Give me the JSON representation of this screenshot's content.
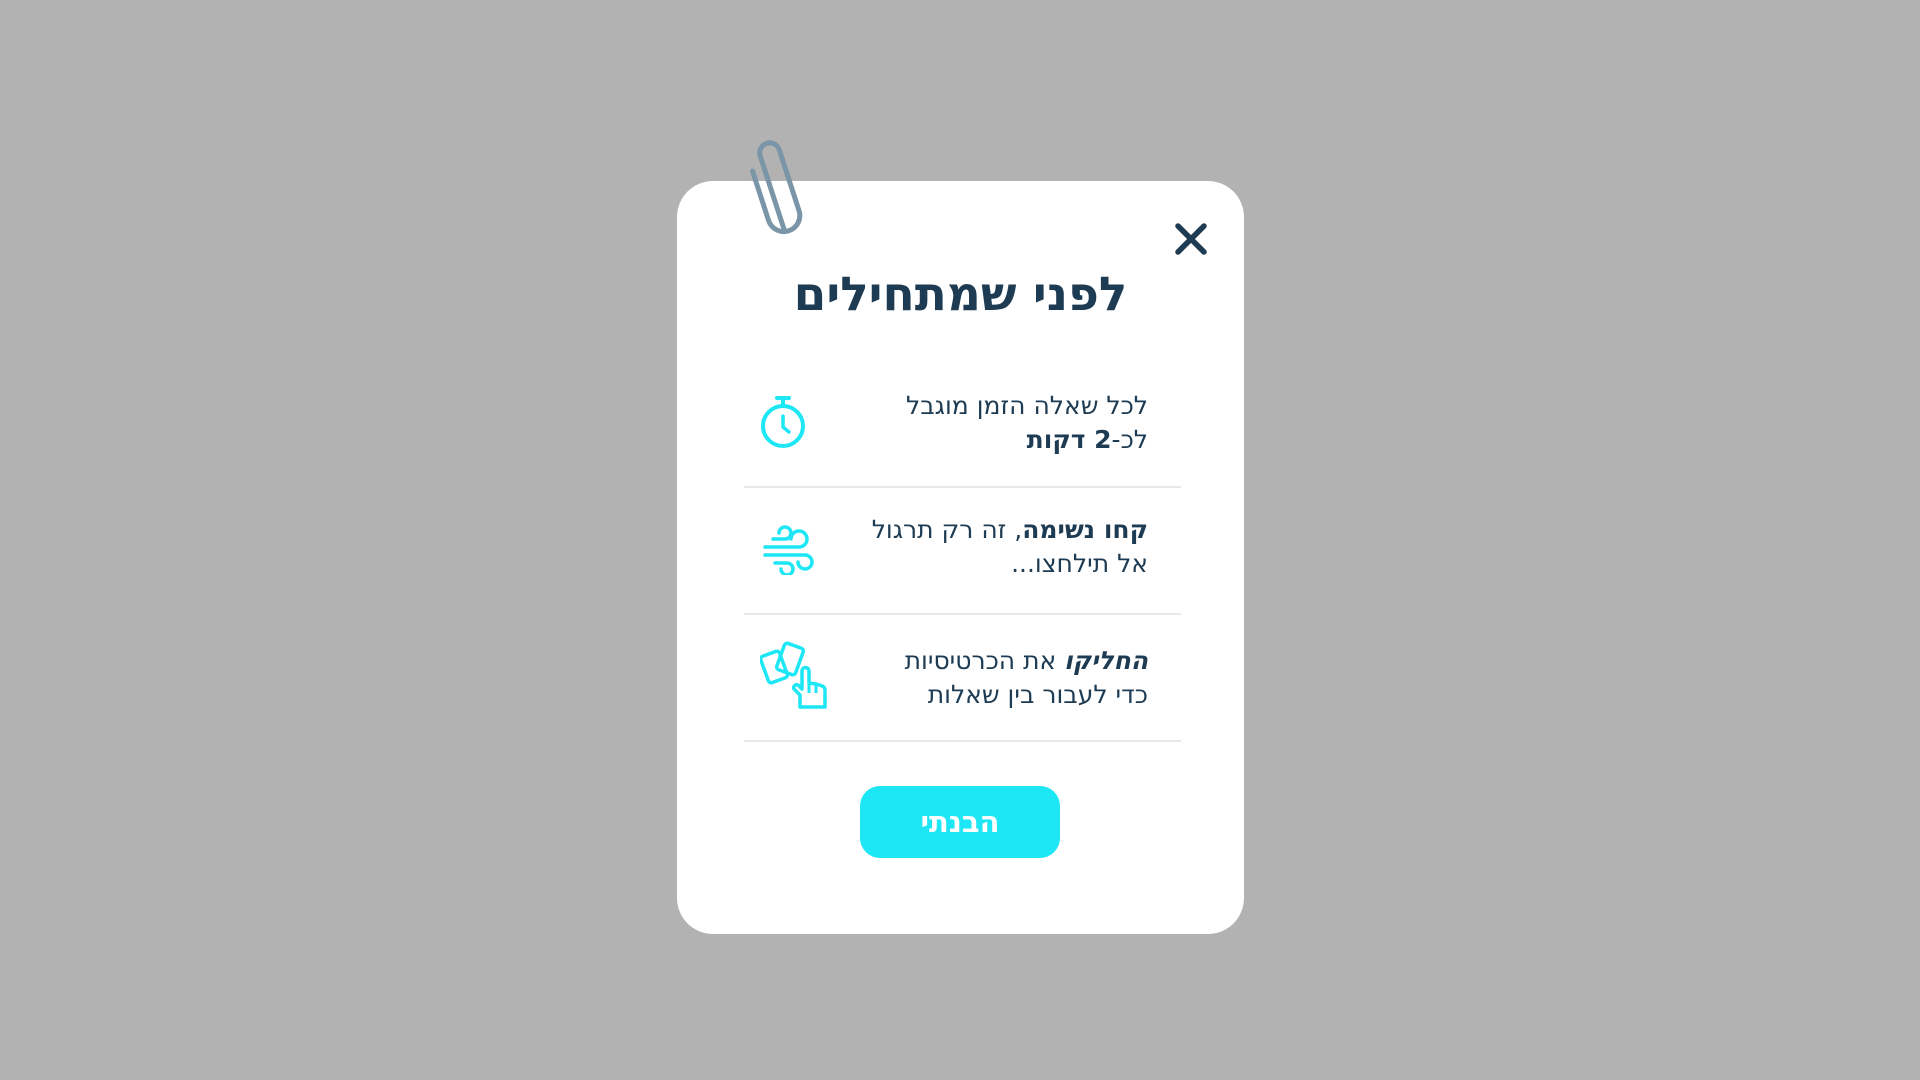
{
  "modal": {
    "title": "לפני שמתחילים",
    "items": [
      {
        "line1": "לכל שאלה הזמן מוגבל",
        "line2_prefix": "לכ-",
        "line2_bold": "2 דקות",
        "icon": "stopwatch-icon"
      },
      {
        "line1_bold": "קחו נשימה",
        "line1_rest": ", זה רק תרגול",
        "line2": "אל תילחצו...",
        "icon": "wind-icon"
      },
      {
        "line1_bold_italic": "החליקו",
        "line1_rest": " את הכרטיסיות",
        "line2": "כדי לעבור בין שאלות",
        "icon": "swipe-cards-icon"
      }
    ],
    "button_label": "הבנתי",
    "close_icon": "close-icon",
    "clip_icon": "paperclip-icon"
  },
  "colors": {
    "overlay": "#b2b2b2",
    "card": "#ffffff",
    "text": "#1d3b53",
    "accent": "#1de6f5",
    "divider": "#e6e9ec",
    "paperclip": "#7a94a8"
  }
}
